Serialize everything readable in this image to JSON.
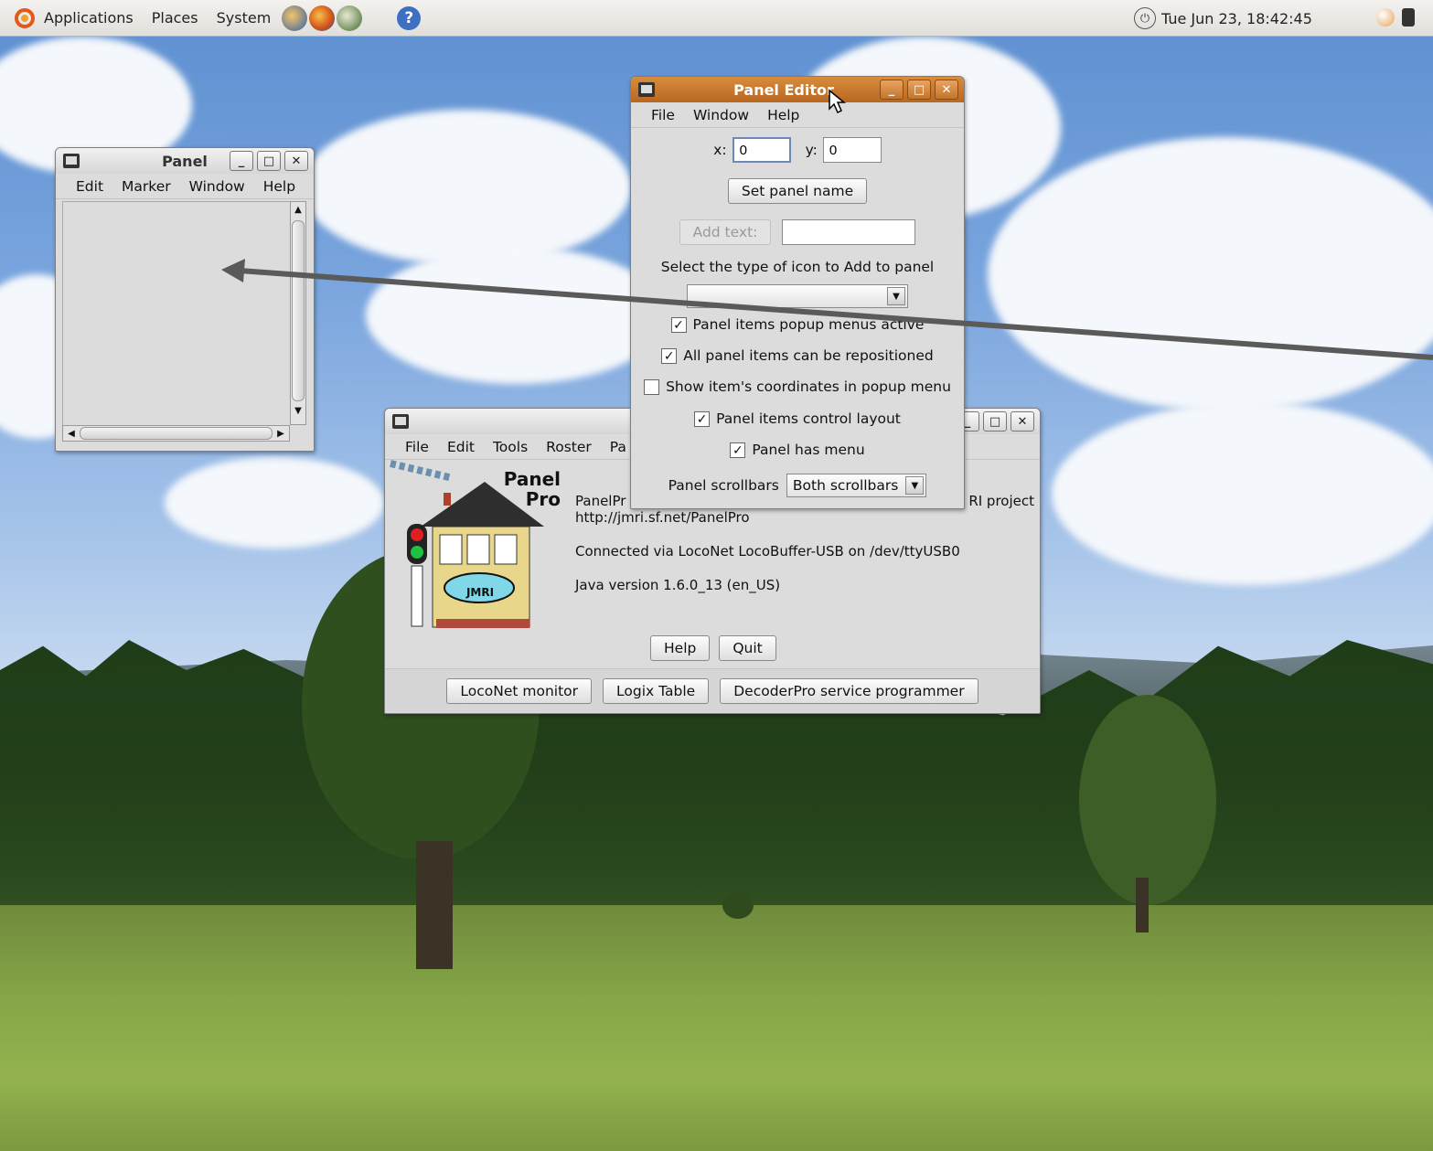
{
  "top_panel": {
    "menus": [
      "Applications",
      "Places",
      "System"
    ],
    "clock": "Tue Jun 23, 18:42:45"
  },
  "panel_window": {
    "title": "Panel",
    "menu": [
      "Edit",
      "Marker",
      "Window",
      "Help"
    ]
  },
  "panel_editor": {
    "title": "Panel Editor",
    "menu": [
      "File",
      "Window",
      "Help"
    ],
    "x_label": "x:",
    "x_value": "0",
    "y_label": "y:",
    "y_value": "0",
    "set_panel_name": "Set panel name",
    "add_text": "Add text:",
    "add_text_value": "",
    "icon_type_label": "Select the type of icon to Add to panel",
    "icon_type_value": "",
    "options": [
      {
        "label": "Panel items popup menus active",
        "checked": true
      },
      {
        "label": "All panel items can be repositioned",
        "checked": true
      },
      {
        "label": "Show item's coordinates in popup menu",
        "checked": false
      },
      {
        "label": "Panel items control layout",
        "checked": true
      },
      {
        "label": "Panel has menu",
        "checked": true
      }
    ],
    "scrollbars_label": "Panel scrollbars",
    "scrollbars_value": "Both scrollbars"
  },
  "panelpro_window": {
    "menu": [
      "File",
      "Edit",
      "Tools",
      "Roster",
      "Pa"
    ],
    "logo_text": "Panel Pro",
    "logo_badge": "JMRI",
    "info_line1_left": "PanelPr",
    "info_line1_right": "RI project",
    "info_url": "http://jmri.sf.net/PanelPro",
    "connection": "Connected via LocoNet LocoBuffer-USB on /dev/ttyUSB0",
    "java_version": "Java version 1.6.0_13 (en_US)",
    "help_button": "Help",
    "quit_button": "Quit",
    "bottom_buttons": [
      "LocoNet monitor",
      "Logix Table",
      "DecoderPro service programmer"
    ]
  },
  "colors": {
    "active_title": "#c97a30",
    "window_bg": "#dcdcdc"
  }
}
